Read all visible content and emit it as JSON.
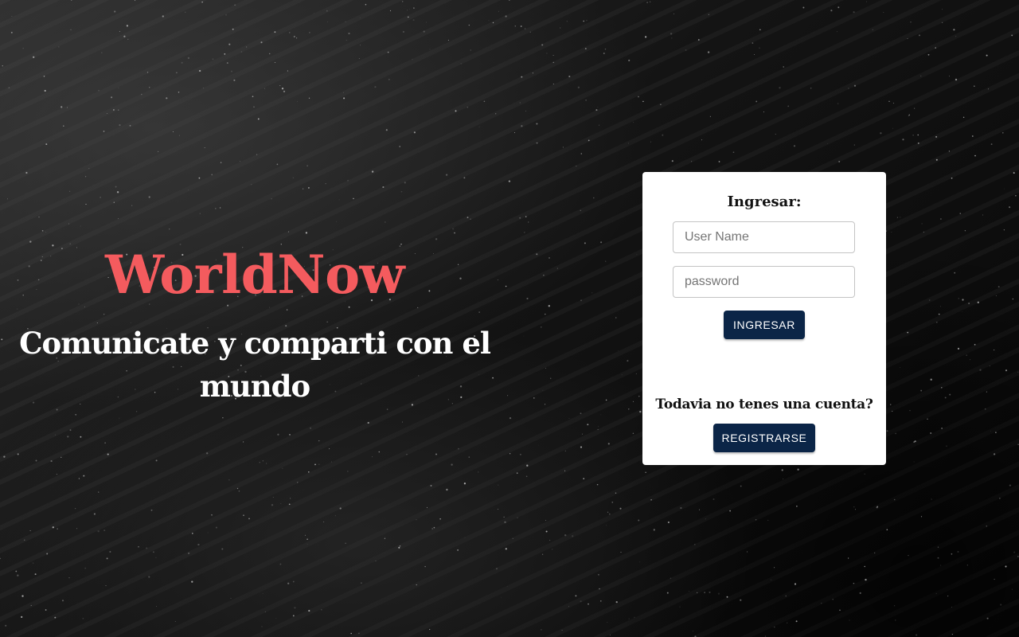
{
  "hero": {
    "brand": "WorldNow",
    "tagline": "Comunicate y comparti con el mundo"
  },
  "login": {
    "title": "Ingresar:",
    "username_placeholder": "User Name",
    "password_placeholder": "password",
    "login_button": "INGRESAR",
    "register_prompt": "Todavia no tenes una cuenta?",
    "register_button": "REGISTRARSE"
  },
  "colors": {
    "brand": "#f45b5e",
    "button": "#0b2547",
    "background": "#0d0d0d",
    "card": "#ffffff"
  }
}
